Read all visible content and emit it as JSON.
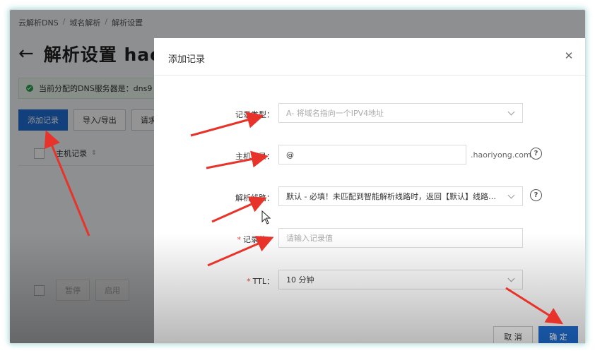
{
  "breadcrumb": [
    "云解析DNS",
    "域名解析",
    "解析设置"
  ],
  "page": {
    "title": "解析设置 hao",
    "dns_notice": "当前分配的DNS服务器是：dns9",
    "toolbar": {
      "add_record": "添加记录",
      "import_export": "导入/导出",
      "request": "请求"
    },
    "table": {
      "col_host": "主机记录"
    },
    "bulk": {
      "pause": "暂停",
      "enable": "启用"
    }
  },
  "dialog": {
    "title": "添加记录",
    "fields": {
      "record_type": {
        "label": "记录类型",
        "value": "A- 将域名指向一个IPV4地址"
      },
      "host": {
        "label": "主机记录",
        "value": "@",
        "suffix": ".haoriyong.com"
      },
      "line": {
        "label": "解析线路",
        "value": "默认 - 必填！未匹配到智能解析线路时，返回【默认】线路设..."
      },
      "record_value": {
        "label": "记录值",
        "placeholder": "请输入记录值"
      },
      "ttl": {
        "label": "TTL",
        "value": "10 分钟"
      }
    },
    "cancel": "取 消",
    "confirm": "确 定"
  },
  "colors": {
    "primary": "#1f6fd6",
    "annotation_arrow": "#e8332a",
    "required": "#e5413c"
  },
  "icons": [
    "back-arrow-icon",
    "check-circle-icon",
    "sort-icon",
    "close-icon",
    "chevron-down-icon",
    "help-circle-icon",
    "mouse-cursor-icon"
  ]
}
